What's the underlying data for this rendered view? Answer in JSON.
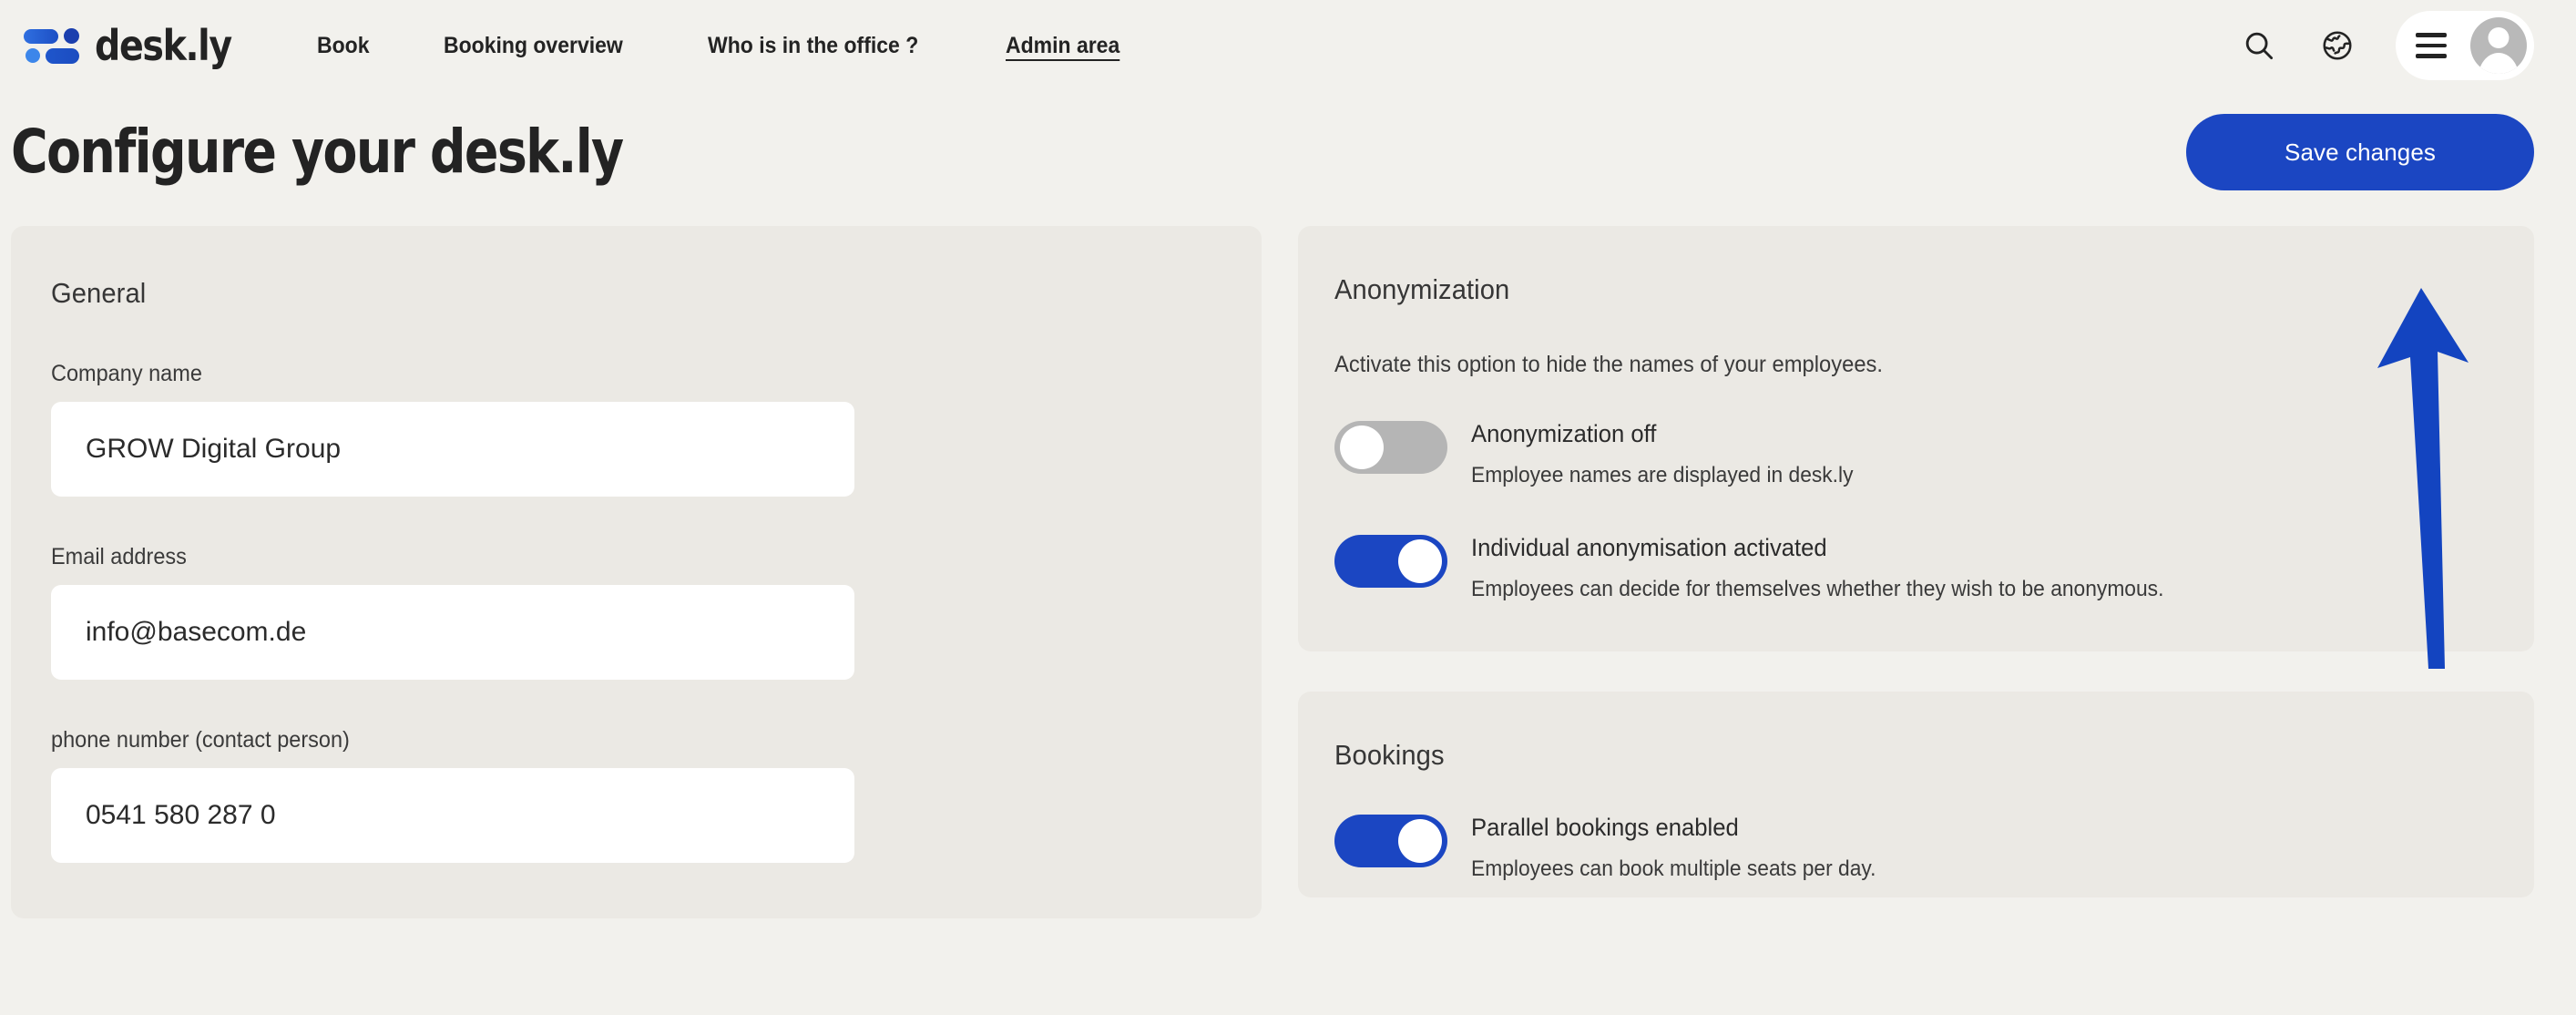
{
  "header": {
    "logo_text": "desk.ly",
    "nav": [
      {
        "label": "Book",
        "active": false
      },
      {
        "label": "Booking overview",
        "active": false
      },
      {
        "label": "Who is in the office ?",
        "active": false
      },
      {
        "label": "Admin area",
        "active": true
      }
    ],
    "icons": {
      "search": "search-icon",
      "globe": "globe-icon",
      "menu": "hamburger-icon",
      "avatar": "user-avatar-icon"
    }
  },
  "page": {
    "title": "Configure your desk.ly",
    "save_label": "Save changes"
  },
  "general": {
    "title": "General",
    "company_label": "Company name",
    "company_value": "GROW Digital Group",
    "email_label": "Email address",
    "email_value": "info@basecom.de",
    "phone_label": "phone number (contact person)",
    "phone_value": "0541 580 287 0"
  },
  "anonymization": {
    "title": "Anonymization",
    "lead": "Activate this option to hide the names of your employees.",
    "options": [
      {
        "title": "Anonymization off",
        "desc": "Employee names are displayed in desk.ly",
        "state": "off"
      },
      {
        "title": "Individual anonymisation activated",
        "desc": "Employees can decide for themselves whether they wish to be anonymous.",
        "state": "on"
      }
    ]
  },
  "bookings": {
    "title": "Bookings",
    "options": [
      {
        "title": "Parallel bookings enabled",
        "desc": "Employees can book multiple seats per day.",
        "state": "on"
      }
    ]
  },
  "annotation": {
    "type": "arrow-up",
    "points_to": "Save changes",
    "color": "#1344c0"
  },
  "colors": {
    "page_bg": "#f2f1ed",
    "card_bg": "#ebe9e4",
    "accent_blue": "#1b46c2",
    "toggle_off": "#b5b5b5",
    "input_bg": "#ffffff",
    "text": "#232323"
  }
}
